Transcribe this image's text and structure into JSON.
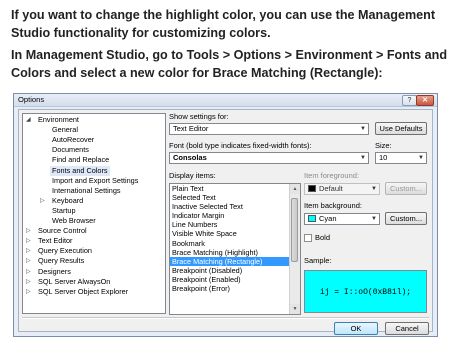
{
  "article": {
    "paragraph1": "If you want to change the highlight color, you can use the Management Studio functionality for customizing colors.",
    "paragraph2": "In Management Studio, go to Tools > Options > Environment > Fonts and Colors and select a new color for Brace Matching (Rectangle):"
  },
  "dialog": {
    "title": "Options",
    "help_glyph": "?",
    "close_glyph": "✕",
    "tree": [
      {
        "label": "Environment",
        "indent": 0,
        "arrow": "◢"
      },
      {
        "label": "General",
        "indent": 1
      },
      {
        "label": "AutoRecover",
        "indent": 1
      },
      {
        "label": "Documents",
        "indent": 1
      },
      {
        "label": "Find and Replace",
        "indent": 1
      },
      {
        "label": "Fonts and Colors",
        "indent": 1,
        "selected": true
      },
      {
        "label": "Import and Export Settings",
        "indent": 1
      },
      {
        "label": "International Settings",
        "indent": 1
      },
      {
        "label": "Keyboard",
        "indent": 1,
        "arrow": "▷"
      },
      {
        "label": "Startup",
        "indent": 1
      },
      {
        "label": "Web Browser",
        "indent": 1
      },
      {
        "label": "Source Control",
        "indent": 0,
        "arrow": "▷"
      },
      {
        "label": "Text Editor",
        "indent": 0,
        "arrow": "▷"
      },
      {
        "label": "Query Execution",
        "indent": 0,
        "arrow": "▷"
      },
      {
        "label": "Query Results",
        "indent": 0,
        "arrow": "▷"
      },
      {
        "label": "Designers",
        "indent": 0,
        "arrow": "▷"
      },
      {
        "label": "SQL Server AlwaysOn",
        "indent": 0,
        "arrow": "▷"
      },
      {
        "label": "SQL Server Object Explorer",
        "indent": 0,
        "arrow": "▷"
      }
    ],
    "show_settings_label": "Show settings for:",
    "show_settings_value": "Text Editor",
    "use_defaults": "Use Defaults",
    "font_label": "Font (bold type indicates fixed-width fonts):",
    "font_value": "Consolas",
    "size_label": "Size:",
    "size_value": "10",
    "display_items_label": "Display items:",
    "display_items": [
      "Plain Text",
      "Selected Text",
      "Inactive Selected Text",
      "Indicator Margin",
      "Line Numbers",
      "Visible White Space",
      "Bookmark",
      "Brace Matching (Highlight)",
      "Brace Matching (Rectangle)",
      "Breakpoint (Disabled)",
      "Breakpoint (Enabled)",
      "Breakpoint (Error)"
    ],
    "selected_item": "Brace Matching (Rectangle)",
    "item_foreground_label": "Item foreground:",
    "item_foreground_value": "Default",
    "item_foreground_color": "#000000",
    "item_background_label": "Item background:",
    "item_background_value": "Cyan",
    "item_background_color": "#00ffff",
    "custom_label": "Custom...",
    "bold_label": "Bold",
    "sample_label": "Sample:",
    "sample_text": "ij = I::oO(0xB81l);",
    "ok": "OK",
    "cancel": "Cancel"
  },
  "colors": {
    "selection": "#3399ff",
    "sample_background": "#00ffff"
  }
}
